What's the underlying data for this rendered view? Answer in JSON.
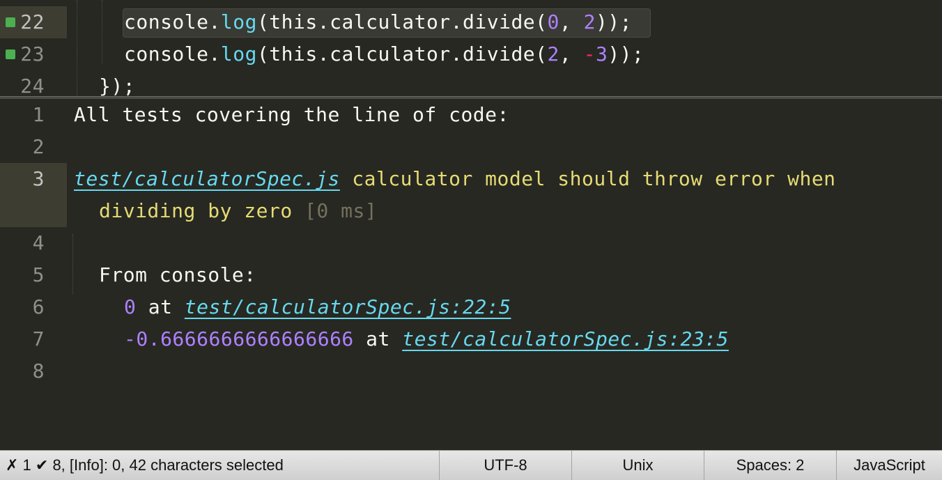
{
  "editor": {
    "top_lines": [
      {
        "num": "22",
        "marker": true,
        "active": true,
        "tokens": [
          {
            "t": "console.",
            "c": ""
          },
          {
            "t": "log",
            "c": "tk-fn"
          },
          {
            "t": "(this.calculator.divide(",
            "c": ""
          },
          {
            "t": "0",
            "c": "tk-num"
          },
          {
            "t": ", ",
            "c": ""
          },
          {
            "t": "2",
            "c": "tk-num"
          },
          {
            "t": "));",
            "c": ""
          }
        ]
      },
      {
        "num": "23",
        "marker": true,
        "active": false,
        "tokens": [
          {
            "t": "console.",
            "c": ""
          },
          {
            "t": "log",
            "c": "tk-fn"
          },
          {
            "t": "(this.calculator.divide(",
            "c": ""
          },
          {
            "t": "2",
            "c": "tk-num"
          },
          {
            "t": ", ",
            "c": ""
          },
          {
            "t": "-",
            "c": "tk-op"
          },
          {
            "t": "3",
            "c": "tk-num"
          },
          {
            "t": "));",
            "c": ""
          }
        ]
      },
      {
        "num": "24",
        "marker": false,
        "active": false,
        "tokens": [
          {
            "t": "});",
            "c": ""
          }
        ]
      }
    ],
    "bottom_lines": [
      {
        "num": "1",
        "tokens": [
          {
            "t": "All tests covering the line of code:",
            "c": ""
          }
        ]
      },
      {
        "num": "2",
        "tokens": []
      },
      {
        "num": "3",
        "tokens": [
          {
            "t": "test/calculatorSpec.js",
            "c": "tk-link"
          },
          {
            "t": " calculator model should throw error when",
            "c": "tk-str"
          }
        ]
      },
      {
        "num": "",
        "tokens": [
          {
            "t": "dividing by zero",
            "c": "tk-str"
          },
          {
            "t": " [0 ms]",
            "c": "tk-dim"
          }
        ]
      },
      {
        "num": "4",
        "tokens": []
      },
      {
        "num": "5",
        "tokens": [
          {
            "t": "From console:",
            "c": ""
          }
        ]
      },
      {
        "num": "6",
        "tokens": [
          {
            "t": "0",
            "c": "tk-purple"
          },
          {
            "t": " at ",
            "c": ""
          },
          {
            "t": "test/calculatorSpec.js:22:5",
            "c": "tk-link"
          }
        ]
      },
      {
        "num": "7",
        "tokens": [
          {
            "t": "-0.6666666666666666",
            "c": "tk-purple"
          },
          {
            "t": " at ",
            "c": ""
          },
          {
            "t": "test/calculatorSpec.js:23:5",
            "c": "tk-link"
          }
        ]
      },
      {
        "num": "8",
        "tokens": []
      }
    ]
  },
  "statusbar": {
    "status_text": "✗ 1 ✔ 8, [Info]: 0, 42 characters selected",
    "encoding": "UTF-8",
    "line_endings": "Unix",
    "indentation": "Spaces: 2",
    "syntax": "JavaScript"
  },
  "colors": {
    "background": "#272822",
    "keyword_cyan": "#66d9ef",
    "number_purple": "#ae81ff",
    "string_yellow": "#e6db74",
    "operator_pink": "#f92672",
    "coverage_green": "#4caf50"
  }
}
